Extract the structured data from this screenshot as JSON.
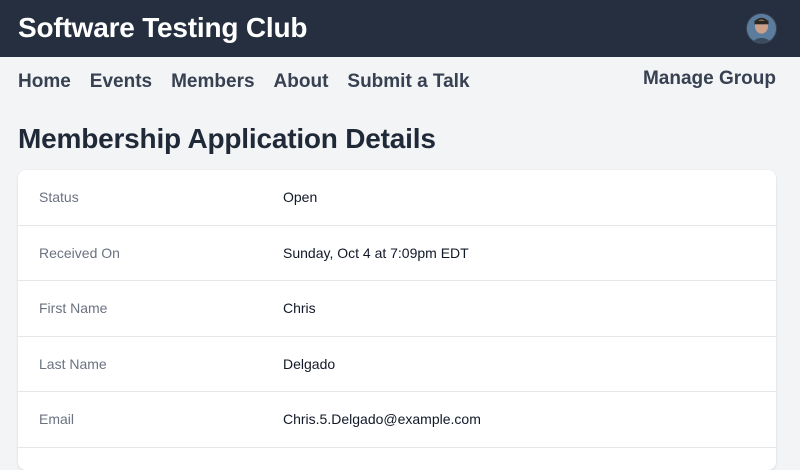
{
  "header": {
    "brand": "Software Testing Club",
    "avatar_icon": "user-avatar-photo"
  },
  "nav": {
    "items": [
      {
        "label": "Home"
      },
      {
        "label": "Events"
      },
      {
        "label": "Members"
      },
      {
        "label": "About"
      },
      {
        "label": "Submit a Talk"
      }
    ],
    "manage_label": "Manage Group"
  },
  "page": {
    "title": "Membership Application Details"
  },
  "details": [
    {
      "label": "Status",
      "value": "Open"
    },
    {
      "label": "Received On",
      "value": "Sunday, Oct 4 at 7:09pm EDT"
    },
    {
      "label": "First Name",
      "value": "Chris"
    },
    {
      "label": "Last Name",
      "value": "Delgado"
    },
    {
      "label": "Email",
      "value": "Chris.5.Delgado@example.com"
    }
  ],
  "colors": {
    "header_bg": "#252f3f",
    "page_bg": "#f3f4f6",
    "card_bg": "#ffffff",
    "label_text": "#6b7280",
    "value_text": "#111827"
  }
}
